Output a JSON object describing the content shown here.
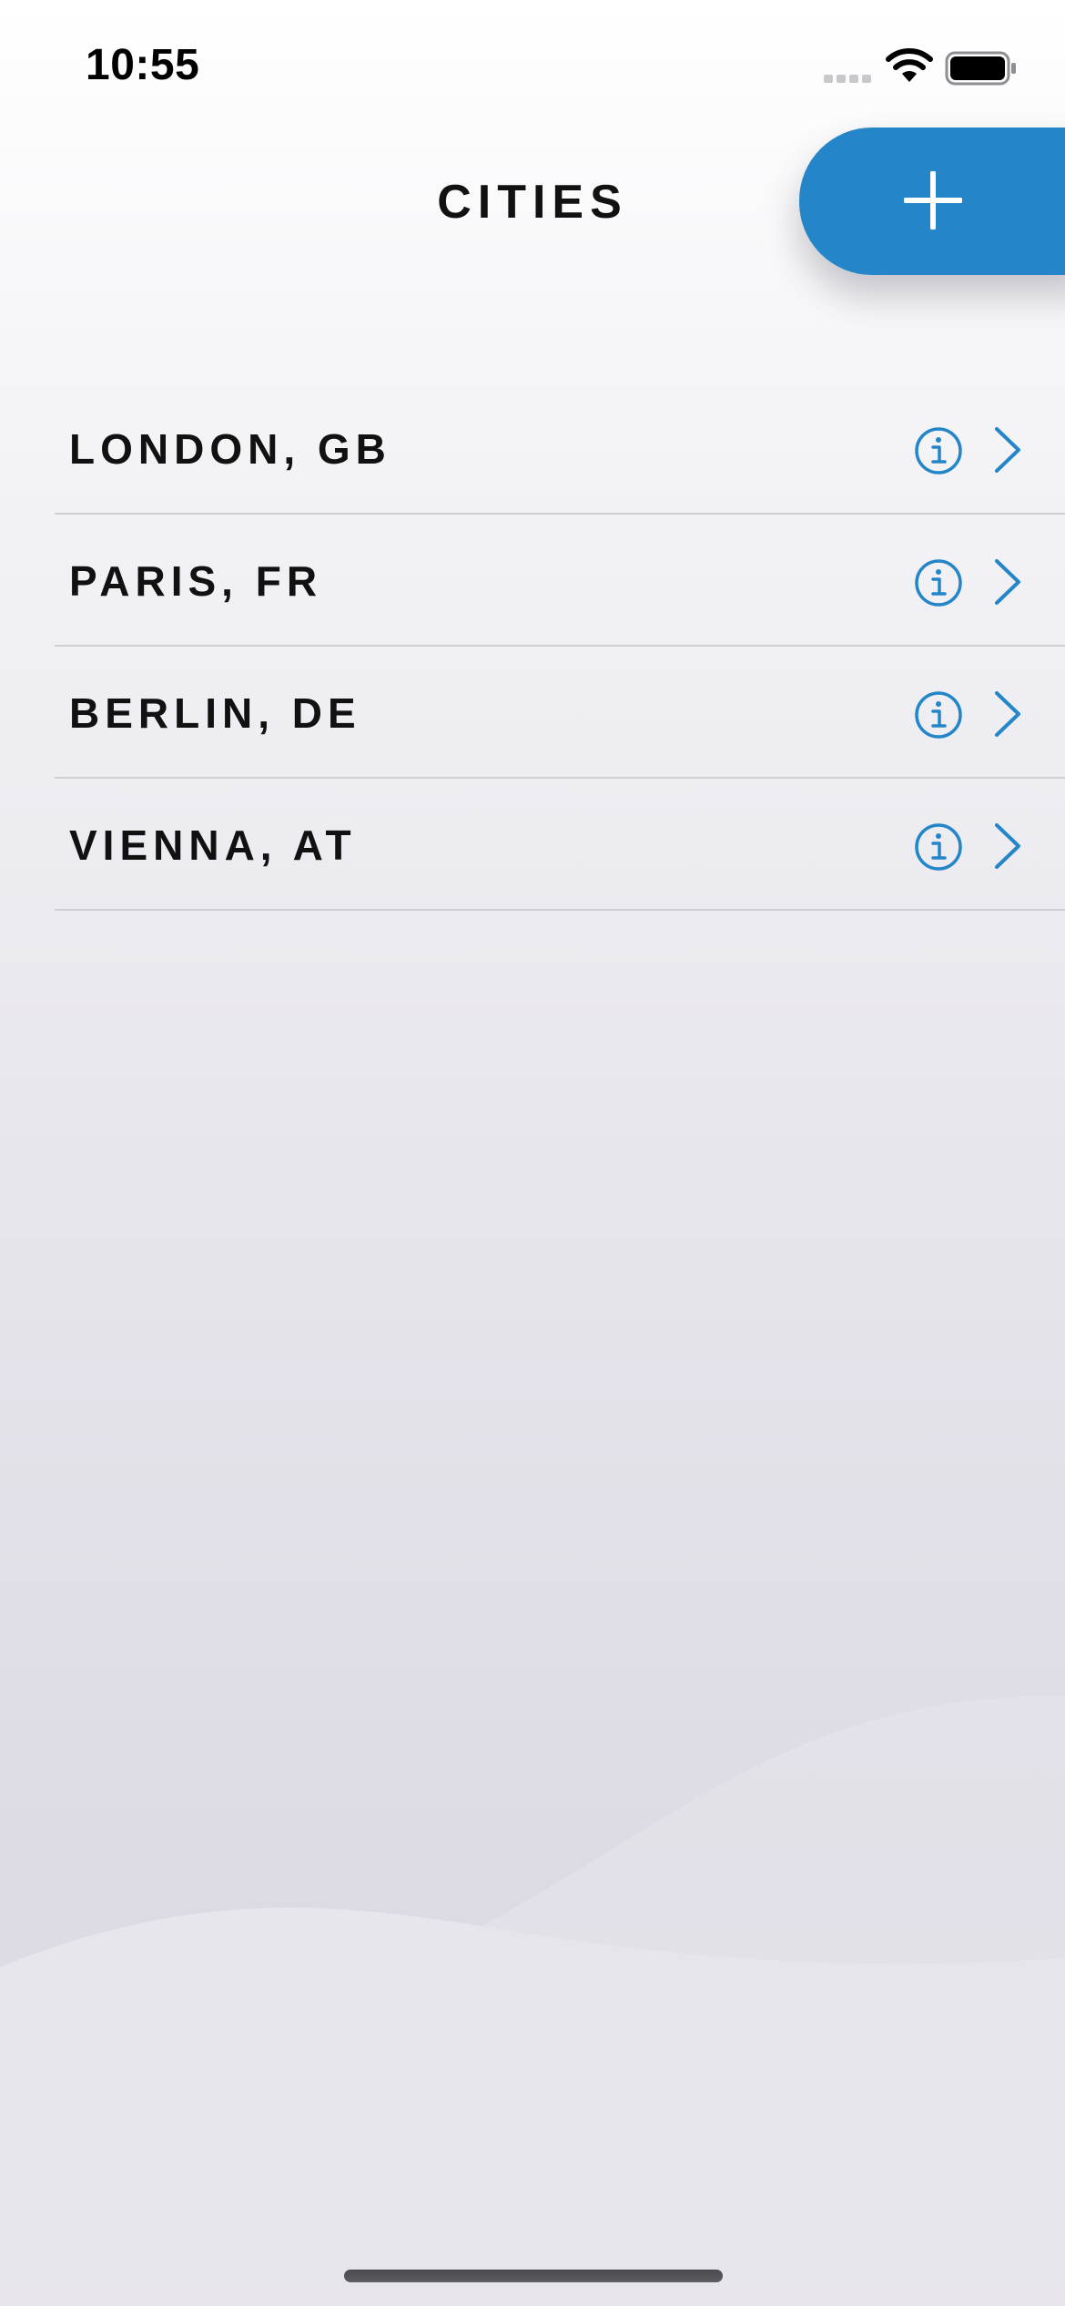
{
  "status_bar": {
    "time": "10:55",
    "signal_icon": "signal-bars-icon",
    "wifi_icon": "wifi-icon",
    "battery_icon": "battery-full-icon"
  },
  "header": {
    "title": "CITIES",
    "add_icon": "plus-icon"
  },
  "cities": [
    {
      "label": "LONDON, GB",
      "info_icon": "info-circle-icon",
      "chevron_icon": "chevron-right-icon"
    },
    {
      "label": "PARIS, FR",
      "info_icon": "info-circle-icon",
      "chevron_icon": "chevron-right-icon"
    },
    {
      "label": "BERLIN, DE",
      "info_icon": "info-circle-icon",
      "chevron_icon": "chevron-right-icon"
    },
    {
      "label": "VIENNA, AT",
      "info_icon": "info-circle-icon",
      "chevron_icon": "chevron-right-icon"
    }
  ],
  "colors": {
    "accent": "#2486c8",
    "text": "#111111",
    "separator": "#cfcfd4"
  }
}
